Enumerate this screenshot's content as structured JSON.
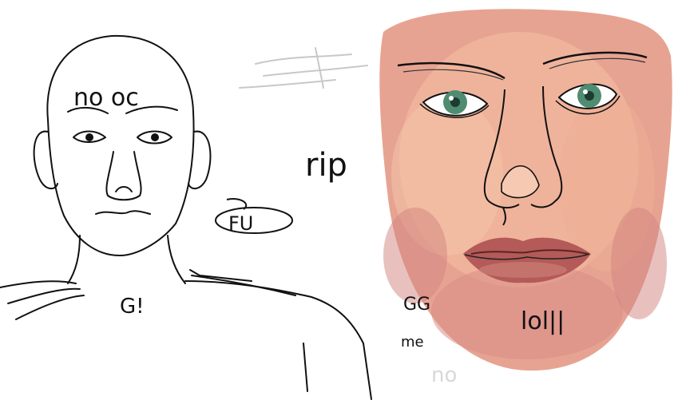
{
  "scribbles": {
    "forehead_text": "no oc",
    "cheek_text": "FU",
    "neck_text": "G!",
    "center_text": "rip",
    "chin_text": "lol||",
    "gg_text": "GG",
    "me_text": "me",
    "faint_text": "no"
  },
  "colors": {
    "line": "#111111",
    "skin_light": "#f2b79a",
    "skin_mid": "#e09a88",
    "skin_dark": "#c9787c",
    "eye": "#4f8c72",
    "lips": "#b45a58",
    "faint": "#c8c8c8"
  }
}
